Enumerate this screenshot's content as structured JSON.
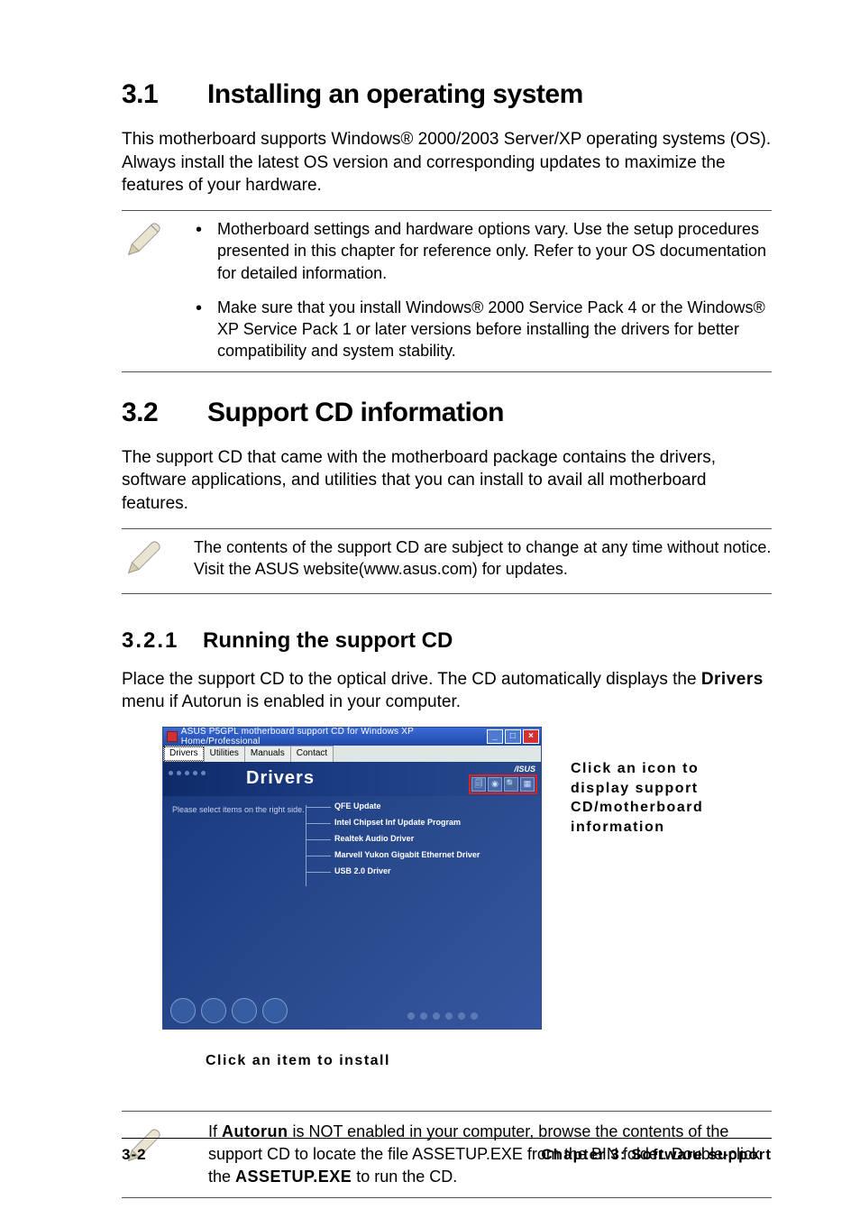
{
  "section1": {
    "number": "3.1",
    "title": "Installing an operating system",
    "paragraph": "This motherboard supports Windows® 2000/2003 Server/XP operating systems (OS). Always install the latest OS version and corresponding updates to maximize the features of your hardware."
  },
  "note1": {
    "items": [
      "Motherboard settings and hardware options vary. Use the setup procedures presented in this chapter for reference only. Refer to your OS documentation for detailed information.",
      "Make sure that you install Windows® 2000 Service Pack 4 or the Windows® XP Service Pack 1 or later versions before installing the drivers for better compatibility and system stability."
    ]
  },
  "section2": {
    "number": "3.2",
    "title": "Support CD information",
    "paragraph": "The support CD that came with the motherboard package contains the drivers, software applications, and utilities that you can install to avail all motherboard features."
  },
  "note2": {
    "text": "The contents of the support CD are subject to change at any time without notice. Visit the ASUS website(www.asus.com) for updates."
  },
  "subsection": {
    "number": "3.2.1",
    "title": "Running the support CD",
    "paragraph_before_bold": "Place the support CD to the optical drive. The CD automatically displays the ",
    "bold_word": "Drivers",
    "paragraph_after_bold": " menu if Autorun is enabled in your computer."
  },
  "window": {
    "title": "ASUS P5GPL motherboard support CD for Windows XP Home/Professional",
    "tabs": [
      "Drivers",
      "Utilities",
      "Manuals",
      "Contact"
    ],
    "banner_title": "Drivers",
    "banner_logo": "/ISUS",
    "left_hint": "Please select items on the right side.",
    "drivers": [
      "QFE Update",
      "Intel Chipset Inf Update Program",
      "Realtek Audio Driver",
      "Marvell Yukon Gigabit Ethernet Driver",
      "USB 2.0 Driver"
    ]
  },
  "captions": {
    "side": "Click an icon to display support CD/motherboard information",
    "below": "Click an item to install"
  },
  "note3": {
    "prefix": "If ",
    "bold1": "Autorun",
    "mid": " is NOT enabled in your computer, browse the contents of the support CD to locate the file ASSETUP.EXE from the BIN folder. Double-click the ",
    "bold2": "ASSETUP.EXE",
    "suffix": " to run the CD."
  },
  "footer": {
    "left": "3-2",
    "right": "Chapter 3: Software support"
  }
}
